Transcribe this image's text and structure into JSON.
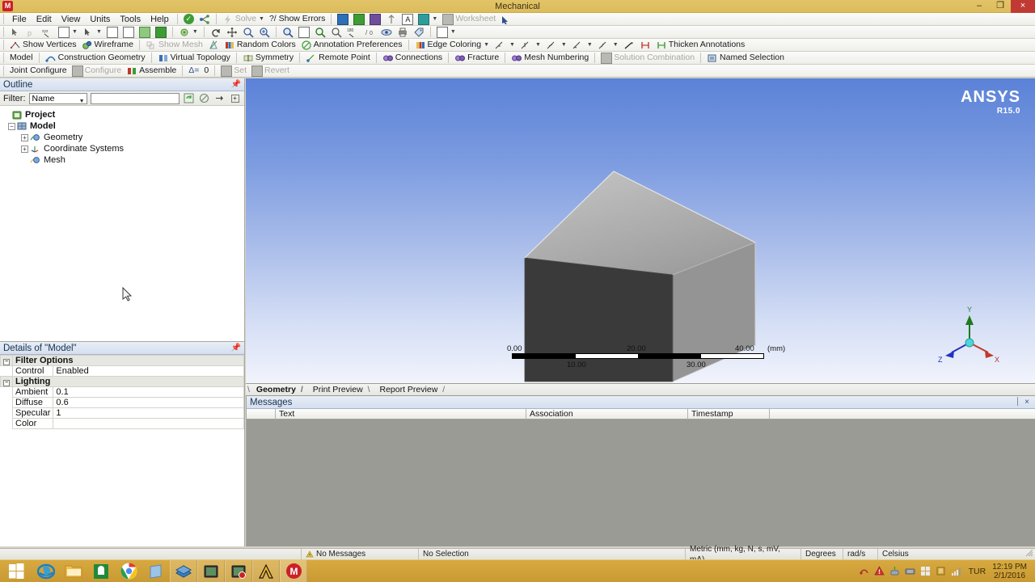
{
  "window": {
    "title": "Mechanical",
    "app_icon": "M",
    "minimize": "–",
    "maximize": "❐",
    "close": "×"
  },
  "menu": {
    "items": [
      {
        "label": "File"
      },
      {
        "label": "Edit"
      },
      {
        "label": "View"
      },
      {
        "label": "Units"
      },
      {
        "label": "Tools"
      },
      {
        "label": "Help"
      }
    ],
    "solve_label": "Solve",
    "show_errors_label": "?/ Show Errors",
    "worksheet_label": "Worksheet"
  },
  "toolbar_display": {
    "show_vertices": "Show Vertices",
    "wireframe": "Wireframe",
    "show_mesh": "Show Mesh",
    "random_colors": "Random Colors",
    "annotation_preferences": "Annotation Preferences",
    "edge_coloring": "Edge Coloring",
    "thicken_annotations": "Thicken Annotations"
  },
  "toolbar_model": {
    "model": "Model",
    "construction_geometry": "Construction Geometry",
    "virtual_topology": "Virtual Topology",
    "symmetry": "Symmetry",
    "remote_point": "Remote Point",
    "connections": "Connections",
    "fracture": "Fracture",
    "mesh_numbering": "Mesh Numbering",
    "solution_combination": "Solution Combination",
    "named_selection": "Named Selection"
  },
  "toolbar_joint": {
    "joint_configure": "Joint Configure",
    "configure": "Configure",
    "assemble": "Assemble",
    "delta_label": "Δ=",
    "delta_value": "0",
    "set": "Set",
    "revert": "Revert"
  },
  "outline": {
    "title": "Outline",
    "filter_label": "Filter:",
    "filter_mode": "Name",
    "filter_value": "",
    "tree": [
      {
        "label": "Project",
        "level": 0,
        "expander": "none",
        "bold": true,
        "icon": "project-icon"
      },
      {
        "label": "Model",
        "level": 1,
        "expander": "minus",
        "bold": true,
        "icon": "model-icon"
      },
      {
        "label": "Geometry",
        "level": 2,
        "expander": "plus",
        "bold": false,
        "icon": "geometry-icon"
      },
      {
        "label": "Coordinate Systems",
        "level": 2,
        "expander": "plus",
        "bold": false,
        "icon": "coordinate-systems-icon"
      },
      {
        "label": "Mesh",
        "level": 2,
        "expander": "none",
        "bold": false,
        "icon": "mesh-icon"
      }
    ]
  },
  "details": {
    "title": "Details of \"Model\"",
    "rows": [
      {
        "type": "group",
        "key": "Filter Options",
        "value": ""
      },
      {
        "type": "row",
        "key": "Control",
        "value": "Enabled"
      },
      {
        "type": "group",
        "key": "Lighting",
        "value": ""
      },
      {
        "type": "row",
        "key": "Ambient",
        "value": "0.1"
      },
      {
        "type": "row",
        "key": "Diffuse",
        "value": "0.6"
      },
      {
        "type": "row",
        "key": "Specular",
        "value": "1"
      },
      {
        "type": "row",
        "key": "Color",
        "value": ""
      }
    ]
  },
  "viewport": {
    "logo_primary": "ANSYS",
    "logo_release": "R15.0",
    "scale_unit": "(mm)",
    "scale_top_labels": [
      "0.00",
      "20.00",
      "40.00"
    ],
    "scale_bottom_labels": [
      "10.00",
      "30.00"
    ],
    "triad": {
      "x": "X",
      "y": "Y",
      "z": "Z"
    }
  },
  "graph_tabs": [
    {
      "label": "Geometry",
      "active": true
    },
    {
      "label": "Print Preview",
      "active": false
    },
    {
      "label": "Report Preview",
      "active": false
    }
  ],
  "messages": {
    "title": "Messages",
    "pin": "⏐",
    "close": "×",
    "columns": [
      "",
      "Text",
      "Association",
      "Timestamp"
    ],
    "rows": []
  },
  "statusbar": {
    "messages": "No Messages",
    "selection": "No Selection",
    "units": "Metric (mm, kg, N, s, mV, mA)",
    "angle": "Degrees",
    "rotation": "rad/s",
    "temperature": "Celsius"
  },
  "taskbar": {
    "items": [
      {
        "name": "start-button",
        "icon": "windows-icon"
      },
      {
        "name": "internet-explorer",
        "icon": "ie-icon"
      },
      {
        "name": "file-explorer",
        "icon": "folder-icon"
      },
      {
        "name": "windows-store",
        "icon": "store-icon"
      },
      {
        "name": "google-chrome",
        "icon": "chrome-icon"
      },
      {
        "name": "reader",
        "icon": "reader-icon"
      },
      {
        "name": "ansys-workbench",
        "icon": "workbench-icon"
      },
      {
        "name": "editor-app",
        "icon": "editor-icon"
      },
      {
        "name": "recording-app",
        "icon": "recorder-icon"
      },
      {
        "name": "ansys-mechanical",
        "icon": "ansys-icon"
      },
      {
        "name": "mechanical-window",
        "icon": "mechanical-icon"
      }
    ],
    "tray": {
      "language": "TUR",
      "time": "12:19 PM",
      "date": "2/1/2016"
    }
  },
  "colors": {
    "titlebar": "#e2c468",
    "taskbar": "#d7a940",
    "accent_blue": "#16324f",
    "viewport_top": "#5b82d8",
    "viewport_bottom": "#f2f4fc",
    "box_front": "#3a3a3a",
    "box_top": "#b0b0b0",
    "box_right": "#959595",
    "axis_x": "#c0392b",
    "axis_y": "#1f7a1f",
    "axis_z": "#2433c0"
  }
}
